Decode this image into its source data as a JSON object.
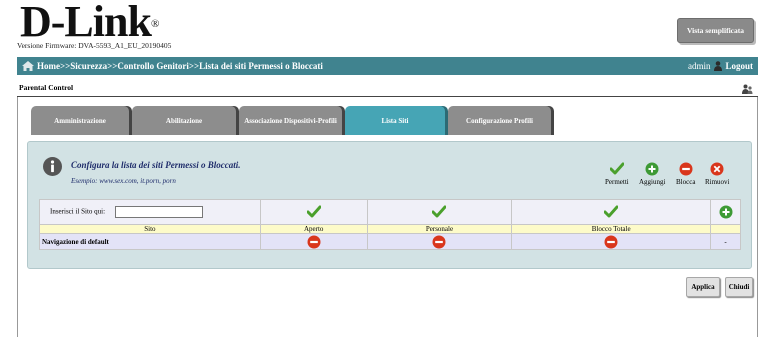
{
  "header": {
    "logo_text": "D-Link",
    "logo_reg": "®",
    "firmware_label": "Versione Firmware: DVA-5593_A1_EU_20190405",
    "simple_view_label": "Vista semplificata"
  },
  "navbar": {
    "breadcrumb": "Home>>Sicurezza>>Controllo Genitori>>Lista dei siti Permessi o Bloccati",
    "admin_label": "admin",
    "logout_label": "Logout"
  },
  "section": {
    "title": "Parental Control"
  },
  "tabs": [
    {
      "label": "Amministrazione",
      "active": false
    },
    {
      "label": "Abilitazione",
      "active": false
    },
    {
      "label": "Associazione Dispositivi-Profili",
      "active": false
    },
    {
      "label": "Lista Siti",
      "active": true
    },
    {
      "label": "Configurazione Profili",
      "active": false
    }
  ],
  "panel": {
    "title": "Configura la lista dei siti Permessi o Bloccati.",
    "example": "Esempio: www.sex.com, it.porn, porn",
    "legend": [
      {
        "label": "Permetti",
        "icon": "check-icon"
      },
      {
        "label": "Aggiungi",
        "icon": "plus-circle-icon"
      },
      {
        "label": "Blocca",
        "icon": "minus-circle-icon"
      },
      {
        "label": "Rimuovi",
        "icon": "x-circle-icon"
      }
    ]
  },
  "table": {
    "input_label": "Inserisci il Sito qui:",
    "input_value": "",
    "columns": [
      "Sito",
      "Aperto",
      "Personale",
      "Blocco Totale"
    ],
    "default_row": {
      "name": "Navigazione di default",
      "aperto": "blocked",
      "personale": "blocked",
      "blocco_totale": "blocked",
      "action": "-"
    }
  },
  "footer": {
    "apply_label": "Applica",
    "close_label": "Chiudi"
  },
  "colors": {
    "navbar": "#40838f",
    "active_tab": "#46a5b5",
    "inactive_tab": "#8d8d8d",
    "panel_bg": "#d2e2e4",
    "check_green": "#4aa02c",
    "block_red": "#d9361c"
  }
}
